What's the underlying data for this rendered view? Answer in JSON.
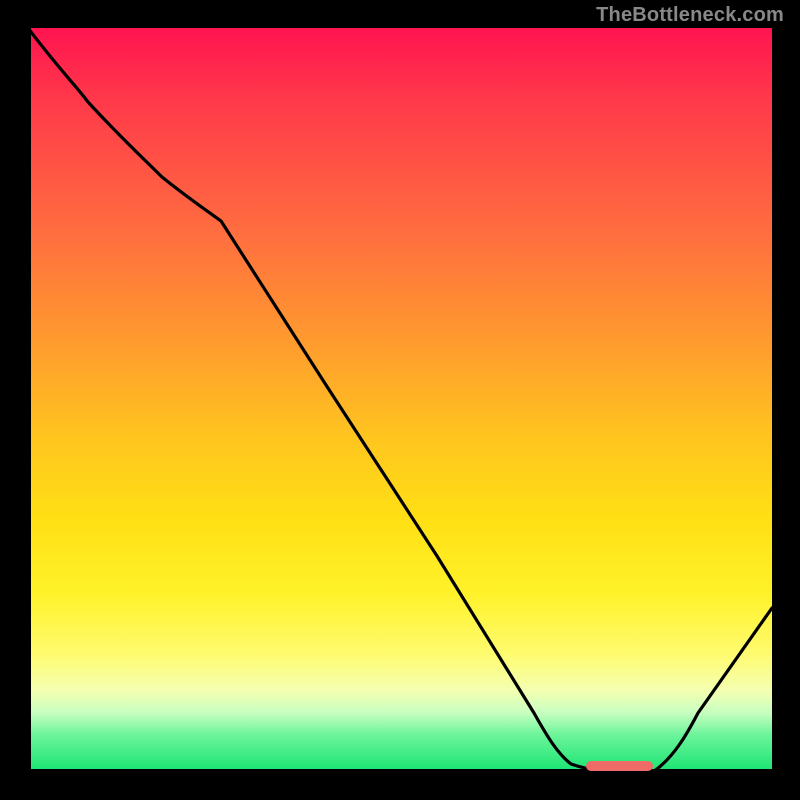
{
  "watermark": "TheBottleneck.com",
  "chart_data": {
    "type": "line",
    "title": "",
    "xlabel": "",
    "ylabel": "",
    "xlim": [
      0,
      100
    ],
    "ylim": [
      0,
      100
    ],
    "grid": false,
    "legend": false,
    "background_gradient": {
      "orientation": "vertical",
      "stops": [
        {
          "pos": 0.0,
          "color": "#ff1450"
        },
        {
          "pos": 0.28,
          "color": "#ff6f3f"
        },
        {
          "pos": 0.55,
          "color": "#ffc51f"
        },
        {
          "pos": 0.76,
          "color": "#fff22a"
        },
        {
          "pos": 0.92,
          "color": "#c8ffc0"
        },
        {
          "pos": 1.0,
          "color": "#18e472"
        }
      ]
    },
    "series": [
      {
        "name": "bottleneck-curve",
        "color": "#000000",
        "x": [
          0,
          8,
          18,
          26,
          40,
          55,
          68,
          73,
          80,
          84,
          90,
          100
        ],
        "y": [
          100,
          90,
          80,
          74,
          52,
          29,
          8,
          1,
          0,
          0,
          8,
          22
        ]
      }
    ],
    "marker": {
      "name": "optimal-range",
      "color": "#ef6b68",
      "x_start": 75,
      "x_end": 84,
      "y": 0
    }
  }
}
